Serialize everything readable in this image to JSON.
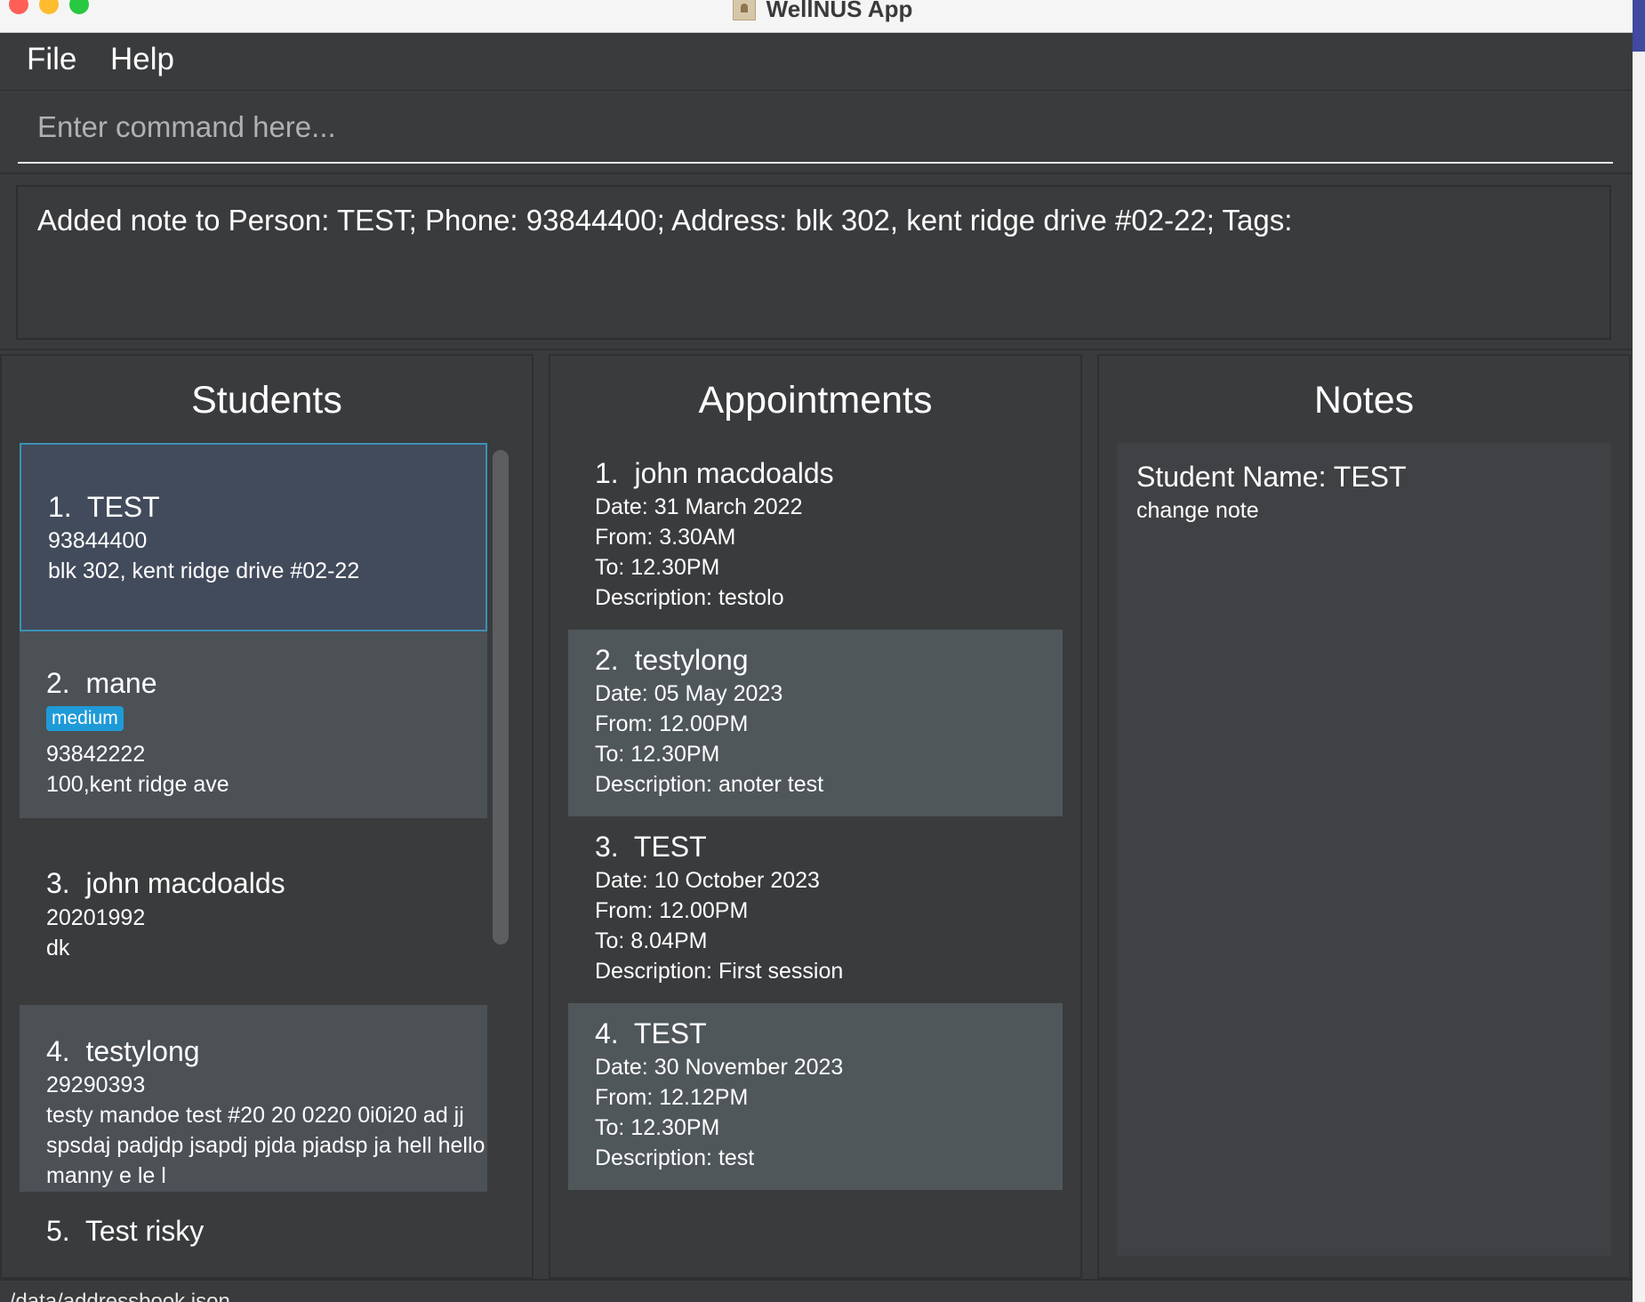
{
  "window": {
    "title": "WellNUS App"
  },
  "menu": {
    "file_label": "File",
    "help_label": "Help"
  },
  "command": {
    "placeholder": "Enter command here..."
  },
  "result": {
    "text": "Added note to Person: TEST; Phone: 93844400; Address: blk 302, kent ridge drive #02-22; Tags:"
  },
  "students": {
    "title": "Students",
    "items": [
      {
        "index": "1.",
        "name": "TEST",
        "tags": [],
        "phone": "93844400",
        "address": "blk 302, kent ridge drive #02-22"
      },
      {
        "index": "2.",
        "name": "mane",
        "tags": [
          "medium"
        ],
        "phone": "93842222",
        "address": "100,kent ridge ave"
      },
      {
        "index": "3.",
        "name": "john macdoalds",
        "tags": [],
        "phone": "20201992",
        "address": "dk"
      },
      {
        "index": "4.",
        "name": "testylong",
        "tags": [],
        "phone": "29290393",
        "address_lines": [
          "testy mandoe test #20 20 0220 0i0i20 ad jj",
          "spsdaj padjdp jsapdj pjda pjadsp ja hell hello",
          "manny e le l"
        ]
      },
      {
        "index": "5.",
        "name": "Test risky"
      }
    ]
  },
  "appointments": {
    "title": "Appointments",
    "items": [
      {
        "index": "1.",
        "name": "john macdoalds",
        "date": "Date: 31 March 2022",
        "from": "From: 3.30AM",
        "to": "To: 12.30PM",
        "description": "Description: testolo"
      },
      {
        "index": "2.",
        "name": "testylong",
        "date": "Date: 05 May 2023",
        "from": "From: 12.00PM",
        "to": "To: 12.30PM",
        "description": "Description: anoter test"
      },
      {
        "index": "3.",
        "name": "TEST",
        "date": "Date: 10 October 2023",
        "from": "From: 12.00PM",
        "to": "To: 8.04PM",
        "description": "Description: First session"
      },
      {
        "index": "4.",
        "name": "TEST",
        "date": "Date: 30 November 2023",
        "from": "From: 12.12PM",
        "to": "To: 12.30PM",
        "description": "Description: test"
      }
    ]
  },
  "notes": {
    "title": "Notes",
    "student_name": "Student Name: TEST",
    "content": "change note"
  },
  "status": {
    "text": "./data/addressbook.json"
  },
  "colors": {
    "background": "#3a3b3d",
    "selected_card": "#424b5b",
    "selected_border": "#3b91b5",
    "tag": "#1f9ad8"
  }
}
